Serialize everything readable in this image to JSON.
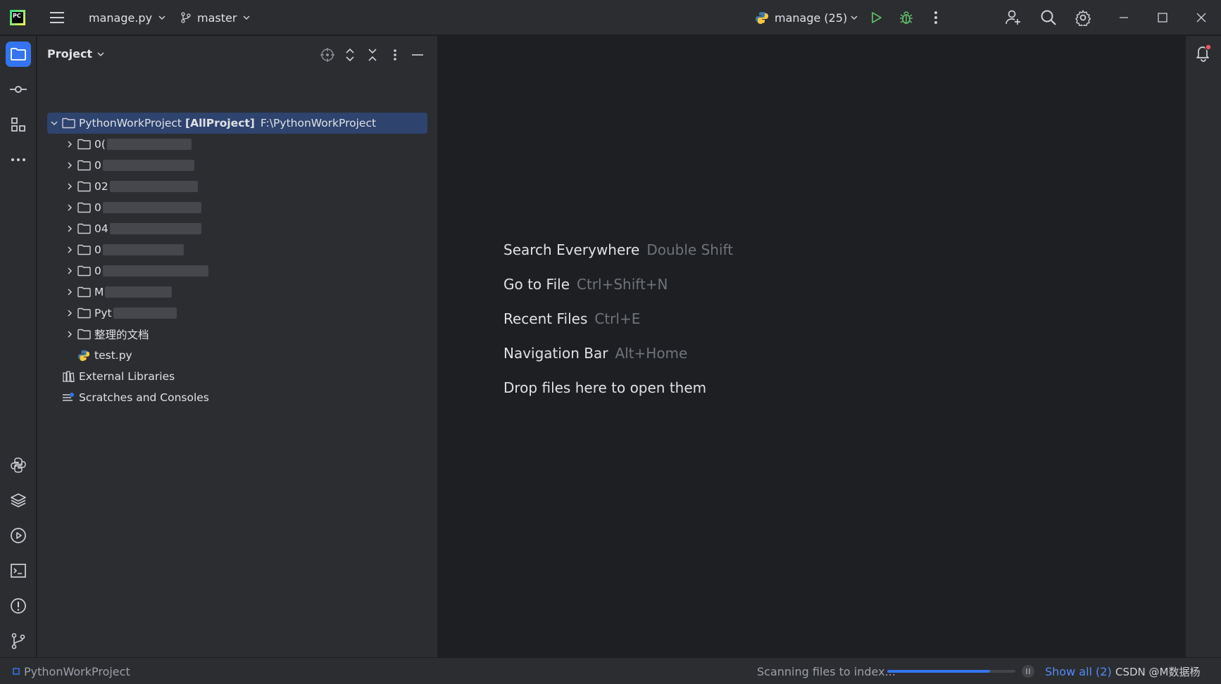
{
  "titlebar": {
    "logo_text": "PC",
    "file_menu": "manage.py",
    "branch": "master",
    "run_config": "manage (25)"
  },
  "project_panel": {
    "title": "Project",
    "root": {
      "name": "PythonWorkProject",
      "module": "[AllProject]",
      "path": "F:\\PythonWorkProject"
    },
    "folders": [
      {
        "label": "0("
      },
      {
        "label": "0"
      },
      {
        "label": "02"
      },
      {
        "label": "0"
      },
      {
        "label": "04"
      },
      {
        "label": "0"
      },
      {
        "label": "0"
      },
      {
        "label": "M"
      },
      {
        "label": "Pyt"
      },
      {
        "label": "整理的文档"
      }
    ],
    "file": "test.py",
    "external_libraries": "External Libraries",
    "scratches": "Scratches and Consoles"
  },
  "editor_hints": [
    {
      "action": "Search Everywhere",
      "shortcut": "Double Shift"
    },
    {
      "action": "Go to File",
      "shortcut": "Ctrl+Shift+N"
    },
    {
      "action": "Recent Files",
      "shortcut": "Ctrl+E"
    },
    {
      "action": "Navigation Bar",
      "shortcut": "Alt+Home"
    },
    {
      "action": "Drop files here to open them",
      "shortcut": ""
    }
  ],
  "statusbar": {
    "project": "PythonWorkProject",
    "scanning": "Scanning files to index...",
    "progress_percent": 80,
    "show_all": "Show all (2)",
    "watermark": "CSDN @M数据杨"
  },
  "colors": {
    "accent": "#3574f0",
    "selection": "#2e436e",
    "run_green": "#5fb865",
    "notification_dot": "#e55765"
  }
}
